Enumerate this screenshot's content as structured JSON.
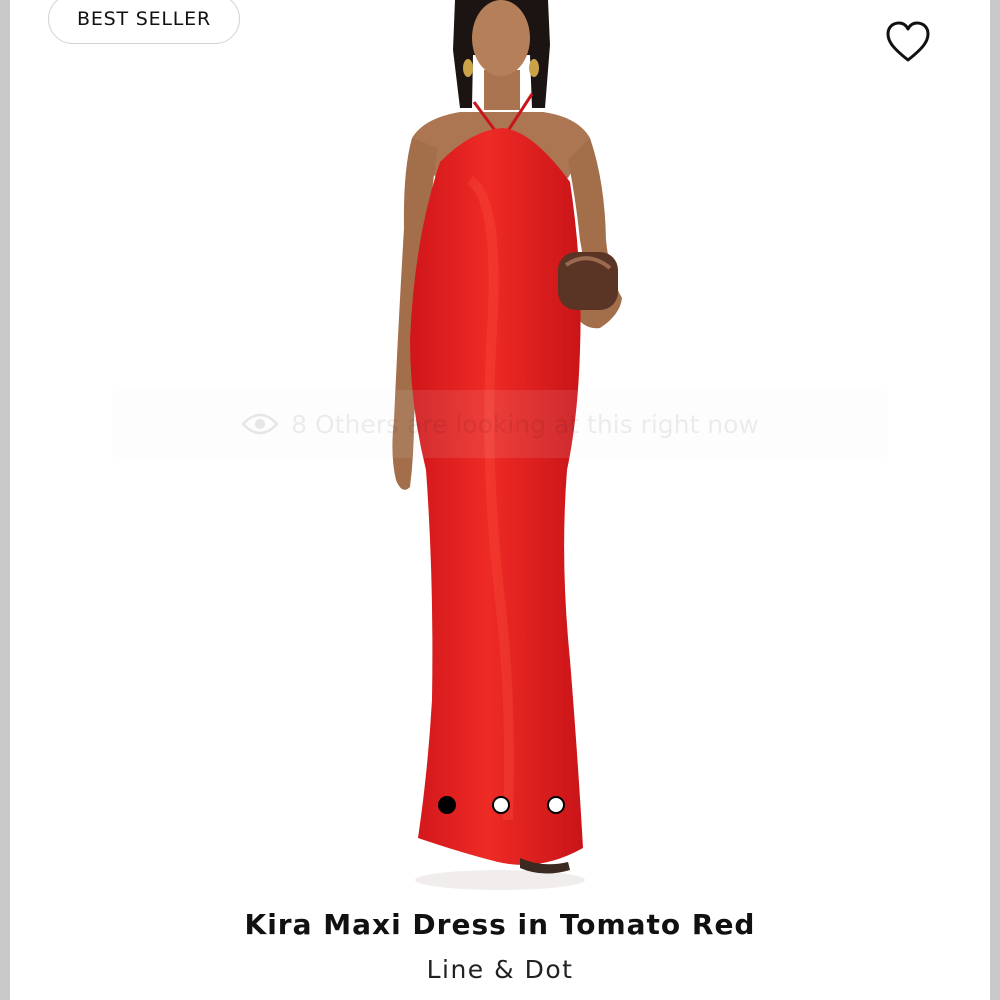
{
  "badge": {
    "label": "BEST SELLER"
  },
  "favorite": {
    "icon": "heart-outline-icon"
  },
  "viewers": {
    "icon": "eye-icon",
    "text": "8 Others are looking at this right now"
  },
  "carousel": {
    "count": 3,
    "active_index": 1
  },
  "product": {
    "title": "Kira Maxi Dress in Tomato Red",
    "brand": "Line & Dot",
    "dress_color": "#e8201f"
  }
}
